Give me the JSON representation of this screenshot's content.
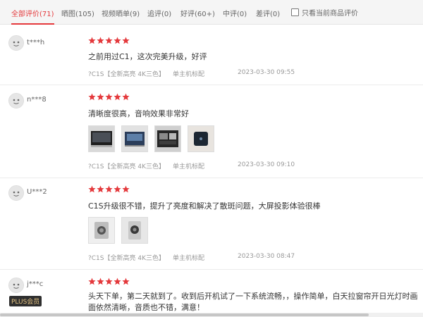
{
  "filter_tabs": [
    {
      "label": "全部评价(71)"
    },
    {
      "label": "晒图(105)"
    },
    {
      "label": "视频晒单(9)"
    },
    {
      "label": "追评(0)"
    },
    {
      "label": "好评(60+)"
    },
    {
      "label": "中评(0)"
    },
    {
      "label": "差评(0)"
    }
  ],
  "only_current_label": "只看当前商品评价",
  "colors": {
    "accent": "#e4393c",
    "plus_badge_text": "#e7c583"
  },
  "reviews": [
    {
      "user": "t***h",
      "stars": 5,
      "text": "之前用过C1，这次完美升级，好评",
      "variant": "?C1S【全新高亮 4K三色】",
      "config": "单主机标配",
      "date": "2023-03-30 09:55"
    },
    {
      "user": "n***8",
      "stars": 5,
      "text": "清晰度很高，音响效果非常好",
      "variant": "?C1S【全新高亮 4K三色】",
      "config": "单主机标配",
      "date": "2023-03-30 09:10"
    },
    {
      "user": "U***2",
      "stars": 5,
      "text": "C1S升级很不错，提升了亮度和解决了散斑问题，大屏投影体验很棒",
      "variant": "?C1S【全新高亮 4K三色】",
      "config": "单主机标配",
      "date": "2023-03-30 08:47"
    },
    {
      "user": "j***c",
      "badge": "PLUS会员",
      "stars": 5,
      "text": "头天下单，第二天就到了。收到后开机试了一下系统流畅，，操作简单，白天拉窗帘开日光灯时画面依然清晰，音质也不错，满意！"
    }
  ]
}
